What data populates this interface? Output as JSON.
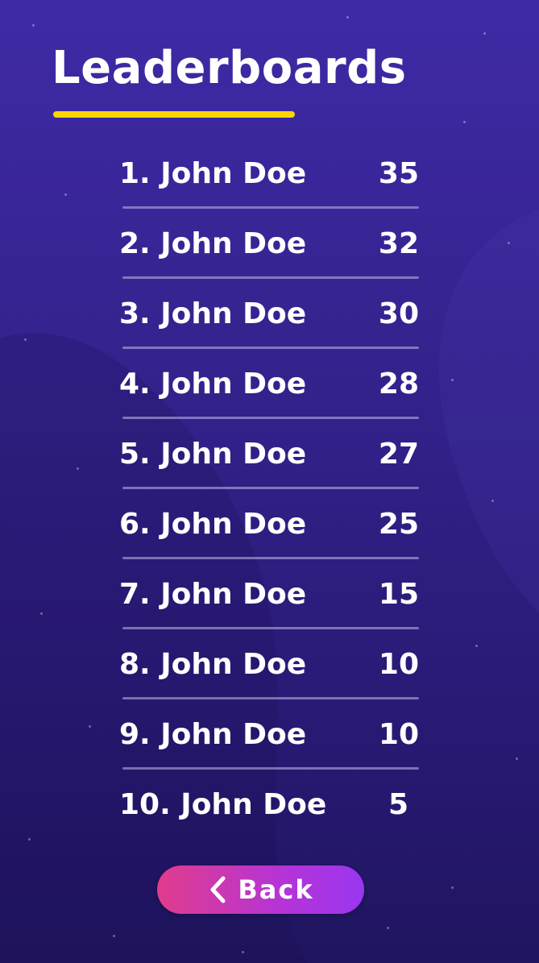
{
  "title": "Leaderboards",
  "colors": {
    "accent": "#ffd400",
    "button_start": "#e13c8c",
    "button_end": "#9a36f0",
    "background_top": "#3f2aa6",
    "background_bottom": "#201560"
  },
  "leaderboard": [
    {
      "name": "1. John Doe",
      "score": "35"
    },
    {
      "name": "2. John Doe",
      "score": "32"
    },
    {
      "name": "3. John Doe",
      "score": "30"
    },
    {
      "name": "4. John Doe",
      "score": "28"
    },
    {
      "name": "5. John Doe",
      "score": "27"
    },
    {
      "name": "6. John Doe",
      "score": "25"
    },
    {
      "name": "7. John Doe",
      "score": "15"
    },
    {
      "name": "8. John Doe",
      "score": "10"
    },
    {
      "name": "9. John Doe",
      "score": "10"
    },
    {
      "name": "10. John Doe",
      "score": "5"
    }
  ],
  "back_button": {
    "label": "Back",
    "icon": "chevron-left-icon"
  }
}
